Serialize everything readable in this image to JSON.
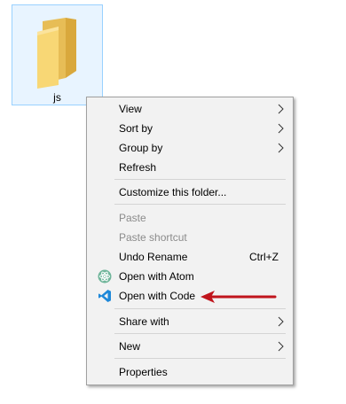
{
  "desktop": {
    "folder": {
      "name": "js"
    }
  },
  "context_menu": {
    "items": [
      {
        "label": "View",
        "submenu": true
      },
      {
        "label": "Sort by",
        "submenu": true
      },
      {
        "label": "Group by",
        "submenu": true
      },
      {
        "label": "Refresh"
      },
      {
        "label": "Customize this folder..."
      },
      {
        "label": "Paste",
        "disabled": true
      },
      {
        "label": "Paste shortcut",
        "disabled": true
      },
      {
        "label": "Undo Rename",
        "shortcut": "Ctrl+Z"
      },
      {
        "label": "Open with Atom",
        "icon": "atom-icon"
      },
      {
        "label": "Open with Code",
        "icon": "vscode-icon"
      },
      {
        "label": "Share with",
        "submenu": true
      },
      {
        "label": "New",
        "submenu": true
      },
      {
        "label": "Properties"
      }
    ]
  },
  "annotation": {
    "arrow_color": "#c0141c",
    "icon": "red-arrow-pointer"
  },
  "colors": {
    "menu_bg": "#f2f2f2",
    "disabled_text": "#8b8b8b",
    "selection_border": "#99d1ff"
  }
}
